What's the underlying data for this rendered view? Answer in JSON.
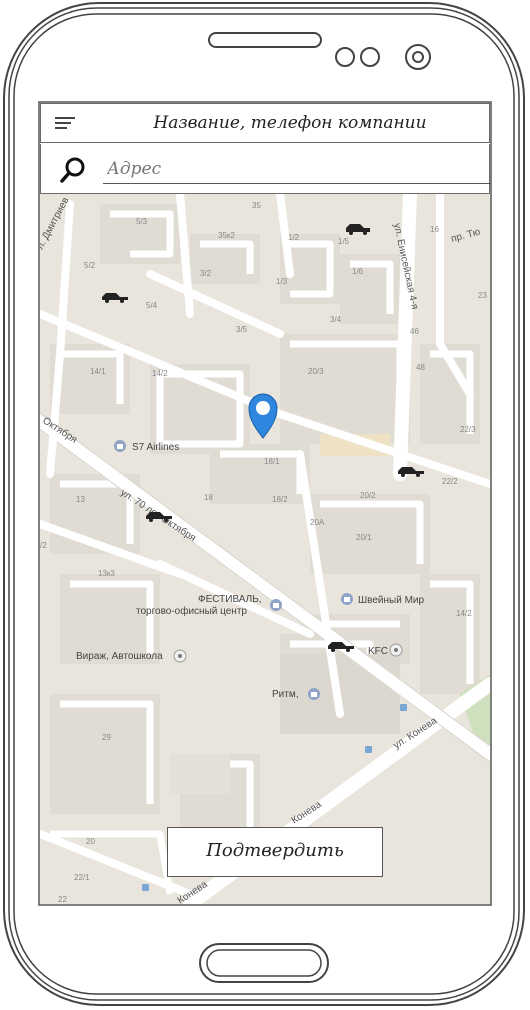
{
  "header": {
    "title": "Название, телефон компании",
    "menu_icon": "menu-icon"
  },
  "search": {
    "placeholder": "Адрес",
    "icon": "search-icon"
  },
  "confirm_button": {
    "label": "Подтвердить"
  },
  "map": {
    "streets": [
      {
        "id": "oktyabrya",
        "label": "ул. 70 лет Октября"
      },
      {
        "id": "oktyabrya-left",
        "label": "Октября"
      },
      {
        "id": "eniseiskaya",
        "label": "ул. Енисейская 4-я"
      },
      {
        "id": "koneva",
        "label": "ул. Конева"
      },
      {
        "id": "koneva2",
        "label": "Конева"
      },
      {
        "id": "koneva3",
        "label": "Конева"
      },
      {
        "id": "dmitrieva",
        "label": "л. Дмитриев"
      },
      {
        "id": "pr-tyu",
        "label": "пр. Тю"
      }
    ],
    "places": [
      {
        "id": "s7",
        "label": "S7 Airlines"
      },
      {
        "id": "festival1",
        "label": "ФЕСТИВАЛЬ,"
      },
      {
        "id": "festival2",
        "label": "торгово-офисный центр"
      },
      {
        "id": "shveiny",
        "label": "Швейный Мир"
      },
      {
        "id": "kfc",
        "label": "KFC"
      },
      {
        "id": "virazh",
        "label": "Вираж, Автошкола"
      },
      {
        "id": "ritm",
        "label": "Ритм,"
      }
    ],
    "house_numbers": [
      "5/3",
      "35",
      "35к2",
      "1/2",
      "1/5",
      "16",
      "5/2",
      "3/2",
      "1/6",
      "1/3",
      "5/4",
      "23",
      "3/5",
      "3/4",
      "46",
      "20/3",
      "48",
      "14/1",
      "14/2",
      "22/3",
      "18/1",
      "22/2",
      "20/2",
      "13",
      "18",
      "18/2",
      "20А",
      "20/1",
      "/2",
      "13к3",
      "14/2",
      "29",
      "20",
      "22/1",
      "22"
    ]
  }
}
